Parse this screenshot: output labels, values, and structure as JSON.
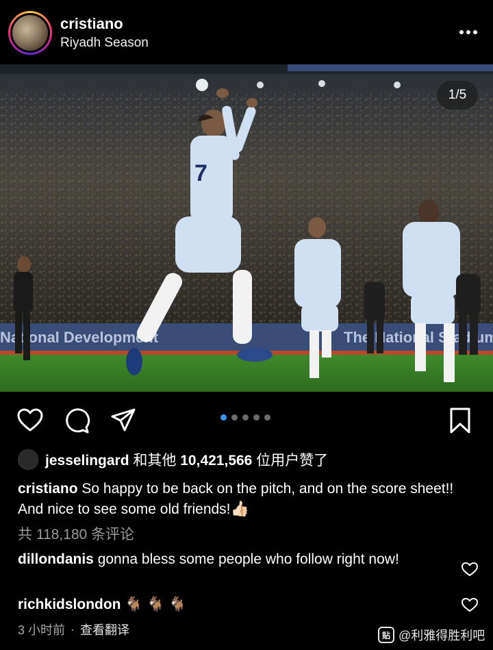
{
  "post": {
    "username": "cristiano",
    "location": "Riyadh Season",
    "image_counter": "1/5",
    "carousel": {
      "count": 5,
      "active_index": 0
    }
  },
  "photo": {
    "banner_left": "National Development",
    "banner_right": "The National Stadium",
    "player_number": "7"
  },
  "likes": {
    "username": "jesselingard",
    "prefix": "和其他",
    "count": "10,421,566",
    "suffix": "位用户赞了"
  },
  "caption": {
    "username": "cristiano",
    "text": "So happy to be back on the pitch, and on the score sheet!! And nice to see some old friends!",
    "emoji": "👍🏻"
  },
  "comments_total": "共 118,180 条评论",
  "comments": [
    {
      "username": "dillondanis",
      "text": "gonna bless some people who follow right now!"
    },
    {
      "username": "richkidslondon",
      "text": "🐐 🐐 🐐"
    }
  ],
  "meta": {
    "time": "3 小时前",
    "separator": "·",
    "translate": "查看翻译"
  },
  "watermark": {
    "logo": "贴",
    "text": "@利雅得胜利吧"
  },
  "colors": {
    "background": "#000000",
    "accent_blue": "#3897f0",
    "muted_text": "#9a9a9a"
  },
  "icons": [
    "more-icon",
    "heart-icon",
    "comment-icon",
    "share-icon",
    "bookmark-icon",
    "heart-small-icon"
  ]
}
